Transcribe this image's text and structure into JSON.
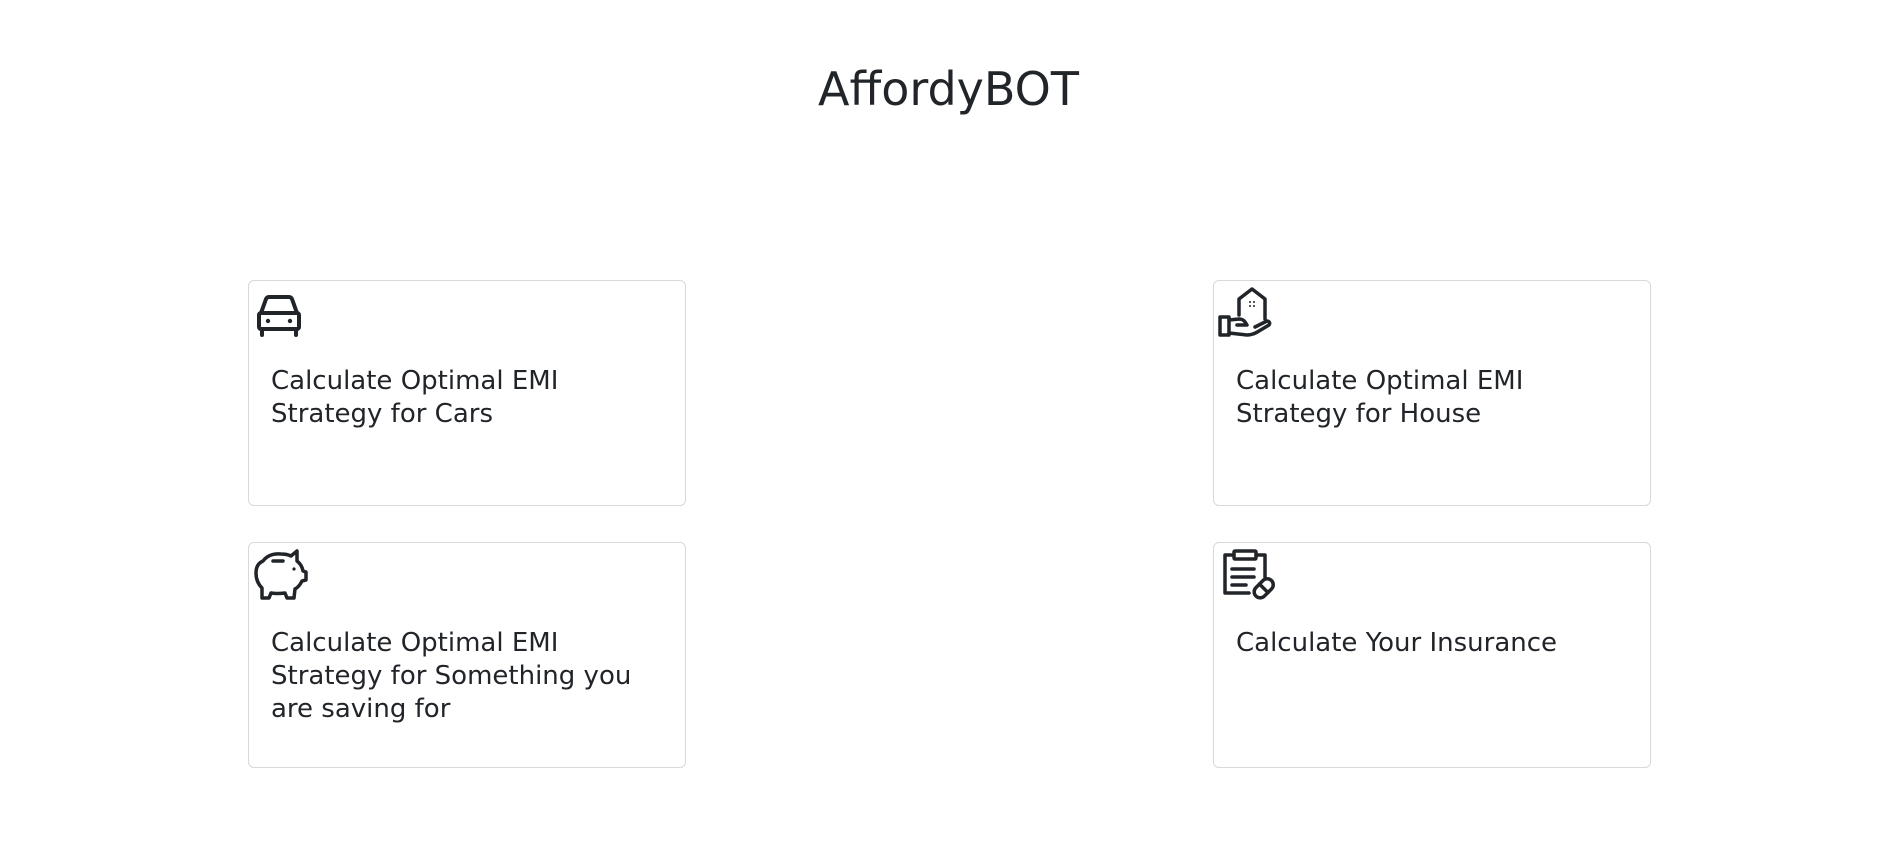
{
  "header": {
    "title": "AffordyBOT"
  },
  "cards": [
    {
      "id": "cars",
      "icon": "car-icon",
      "label": "Calculate Optimal EMI Strategy for Cars"
    },
    {
      "id": "house",
      "icon": "house-hand-icon",
      "label": "Calculate Optimal EMI Strategy for House"
    },
    {
      "id": "savings",
      "icon": "piggy-bank-icon",
      "label": "Calculate Optimal EMI Strategy for Something you are saving for"
    },
    {
      "id": "insurance",
      "icon": "clipboard-pill-icon",
      "label": "Calculate Your Insurance"
    }
  ],
  "colors": {
    "text": "#212529",
    "card_border": "#d9d9d9",
    "background": "#ffffff"
  }
}
